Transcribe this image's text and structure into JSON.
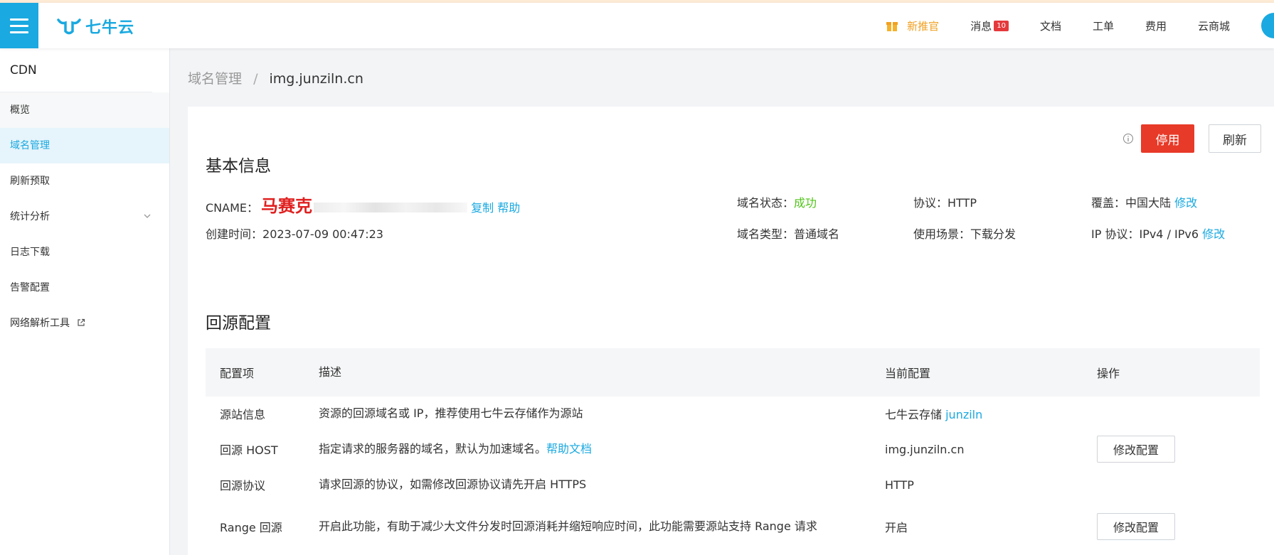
{
  "header": {
    "logo_text": "七牛云",
    "nav": {
      "promo": "新推官",
      "messages": "消息",
      "messages_badge": "10",
      "docs": "文档",
      "tickets": "工单",
      "billing": "费用",
      "market": "云商城"
    }
  },
  "sidebar": {
    "title": "CDN",
    "items": [
      {
        "label": "概览"
      },
      {
        "label": "域名管理"
      },
      {
        "label": "刷新预取"
      },
      {
        "label": "统计分析"
      },
      {
        "label": "日志下载"
      },
      {
        "label": "告警配置"
      },
      {
        "label": "网络解析工具"
      }
    ]
  },
  "breadcrumb": {
    "parent": "域名管理",
    "separator": "/",
    "current": "img.junziln.cn"
  },
  "actions": {
    "stop": "停用",
    "refresh": "刷新"
  },
  "basic": {
    "title": "基本信息",
    "cname_label": "CNAME：",
    "cname_overlay": "马赛克",
    "copy": "复制",
    "help": "帮助",
    "created_label": "创建时间：",
    "created_value": "2023-07-09 00:47:23",
    "status_label": "域名状态：",
    "status_value": "成功",
    "type_label": "域名类型：",
    "type_value": "普通域名",
    "protocol_label": "协议：",
    "protocol_value": "HTTP",
    "scene_label": "使用场景：",
    "scene_value": "下载分发",
    "coverage_label": "覆盖：",
    "coverage_value": "中国大陆",
    "coverage_edit": "修改",
    "ip_label": "IP 协议：",
    "ip_value": "IPv4 / IPv6",
    "ip_edit": "修改"
  },
  "origin": {
    "title": "回源配置",
    "columns": [
      "配置项",
      "描述",
      "当前配置",
      "操作"
    ],
    "rows": [
      {
        "name": "源站信息",
        "desc": "资源的回源域名或 IP，推荐使用七牛云存储作为源站",
        "desc_link": "",
        "current": "七牛云存储",
        "current_link": "junziln",
        "action": ""
      },
      {
        "name": "回源 HOST",
        "desc": "指定请求的服务器的域名，默认为加速域名。",
        "desc_link": "帮助文档",
        "current": "img.junziln.cn",
        "current_link": "",
        "action": "修改配置"
      },
      {
        "name": "回源协议",
        "desc": "请求回源的协议，如需修改回源协议请先开启 HTTPS",
        "desc_link": "",
        "current": "HTTP",
        "current_link": "",
        "action": ""
      },
      {
        "name": "Range 回源",
        "desc": "开启此功能，有助于减少大文件分发时回源消耗并缩短响应时间，此功能需要源站支持 Range 请求",
        "desc_link": "",
        "current": "开启",
        "current_link": "",
        "action": "修改配置"
      }
    ]
  },
  "colors": {
    "accent": "#1aa9e0",
    "danger": "#e83a28",
    "success": "#52c41a"
  }
}
